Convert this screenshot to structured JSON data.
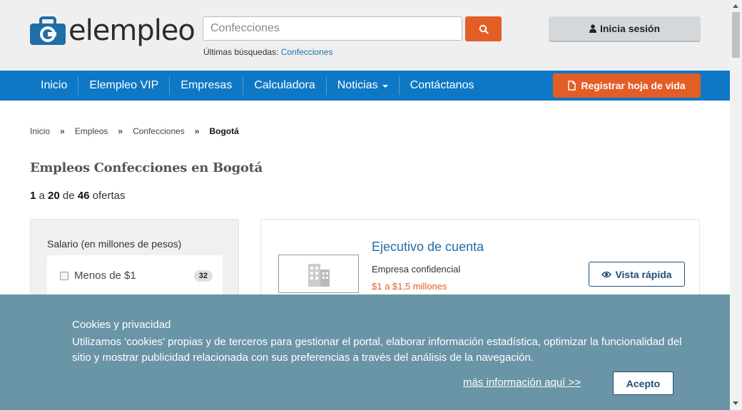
{
  "brand": {
    "name": "elempleo",
    "primary": "#0e78c4",
    "accent": "#e35d26"
  },
  "search": {
    "placeholder": "Confecciones",
    "recent_label": "Últimas búsquedas:",
    "recent_item": "Confecciones"
  },
  "header": {
    "login_label": "Inicia sesión"
  },
  "nav": {
    "items": [
      "Inicio",
      "Elempleo VIP",
      "Empresas",
      "Calculadora",
      "Noticias",
      "Contáctanos"
    ],
    "register_label": "Registrar hoja de vida"
  },
  "breadcrumb": [
    "Inicio",
    "Empleos",
    "Confecciones",
    "Bogotá"
  ],
  "page": {
    "title": "Empleos Confecciones en Bogotá",
    "count_from": "1",
    "count_a": "a",
    "count_to": "20",
    "count_de": "de",
    "count_total": "46",
    "count_suffix": "ofertas"
  },
  "filter": {
    "title": "Salario (en millones de pesos)",
    "options": [
      {
        "label": "Menos de $1",
        "count": "32"
      }
    ]
  },
  "job": {
    "title": "Ejecutivo de cuenta",
    "company": "Empresa confidencial",
    "salary": "$1 a $1,5 millones",
    "quick_view_label": "Vista rápida"
  },
  "cookies": {
    "title": "Cookies y privacidad",
    "text": "Utilizamos 'cookies' propias y de terceros para gestionar el portal, elaborar información estadística, optimizar la funcionalidad del sitio y mostrar publicidad relacionada con sus preferencias a través del análisis de la navegación.",
    "link": "más información aquí >>",
    "accept": "Acepto"
  }
}
